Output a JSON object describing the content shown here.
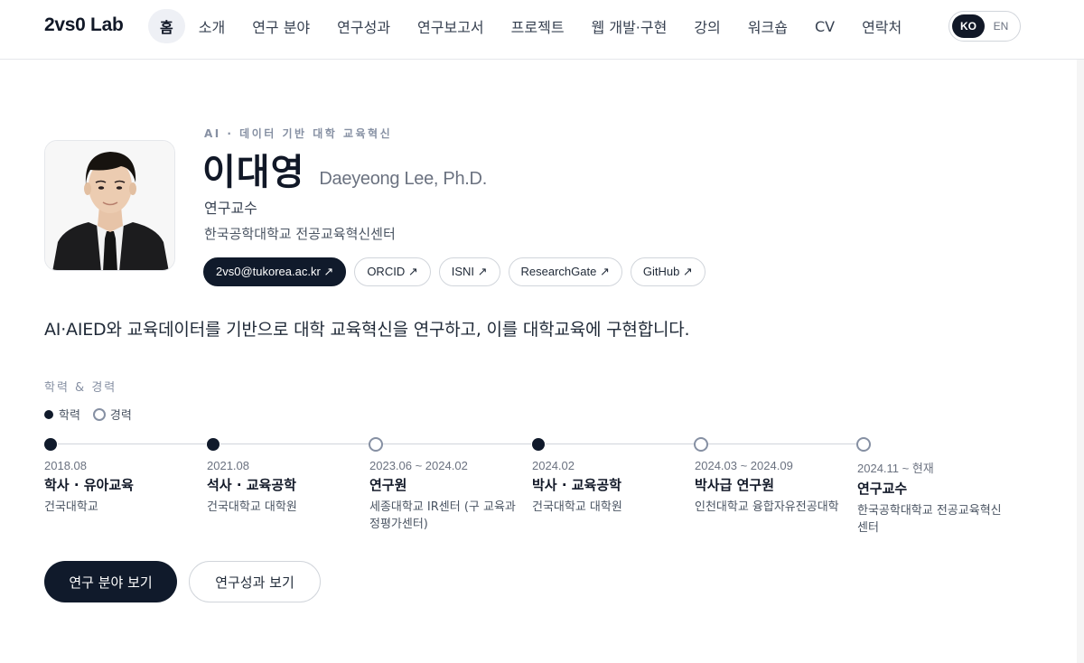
{
  "header": {
    "brand": "2vs0 Lab",
    "nav": [
      {
        "label": "홈",
        "active": true
      },
      {
        "label": "소개"
      },
      {
        "label": "연구 분야"
      },
      {
        "label": "연구성과"
      },
      {
        "label": "연구보고서"
      },
      {
        "label": "프로젝트"
      },
      {
        "label": "웹 개발·구현"
      },
      {
        "label": "강의"
      },
      {
        "label": "워크숍"
      },
      {
        "label": "CV"
      },
      {
        "label": "연락처"
      }
    ],
    "lang": {
      "ko": "KO",
      "en": "EN",
      "selected": "KO"
    }
  },
  "profile": {
    "eyebrow": "AI · 데이터 기반 대학 교육혁신",
    "name_ko": "이대영",
    "name_en": "Daeyeong Lee, Ph.D.",
    "role": "연구교수",
    "affiliation": "한국공학대학교 전공교육혁신센터",
    "links": [
      {
        "label": "2vs0@tukorea.ac.kr ↗",
        "primary": true
      },
      {
        "label": "ORCID ↗"
      },
      {
        "label": "ISNI ↗"
      },
      {
        "label": "ResearchGate ↗"
      },
      {
        "label": "GitHub ↗"
      }
    ]
  },
  "lead": "AI·AIED와 교육데이터를 기반으로 대학 교육혁신을 연구하고, 이를 대학교육에 구현합니다.",
  "timeline": {
    "title": "학력 & 경력",
    "legend": {
      "education": "학력",
      "career": "경력"
    },
    "items": [
      {
        "type": "education",
        "date": "2018.08",
        "head": "학사 · 유아교육",
        "place": "건국대학교"
      },
      {
        "type": "education",
        "date": "2021.08",
        "head": "석사 · 교육공학",
        "place": "건국대학교 대학원"
      },
      {
        "type": "career",
        "date": "2023.06 ~ 2024.02",
        "head": "연구원",
        "place": "세종대학교 IR센터 (구 교육과정평가센터)"
      },
      {
        "type": "education",
        "date": "2024.02",
        "head": "박사 · 교육공학",
        "place": "건국대학교 대학원"
      },
      {
        "type": "career",
        "date": "2024.03 ~ 2024.09",
        "head": "박사급 연구원",
        "place": "인천대학교 융합자유전공대학"
      },
      {
        "type": "career",
        "date": "2024.11 ~ 현재",
        "head": "연구교수",
        "place": "한국공학대학교 전공교육혁신센터"
      }
    ]
  },
  "actions": {
    "primary": "연구 분야 보기",
    "secondary": "연구성과 보기"
  }
}
